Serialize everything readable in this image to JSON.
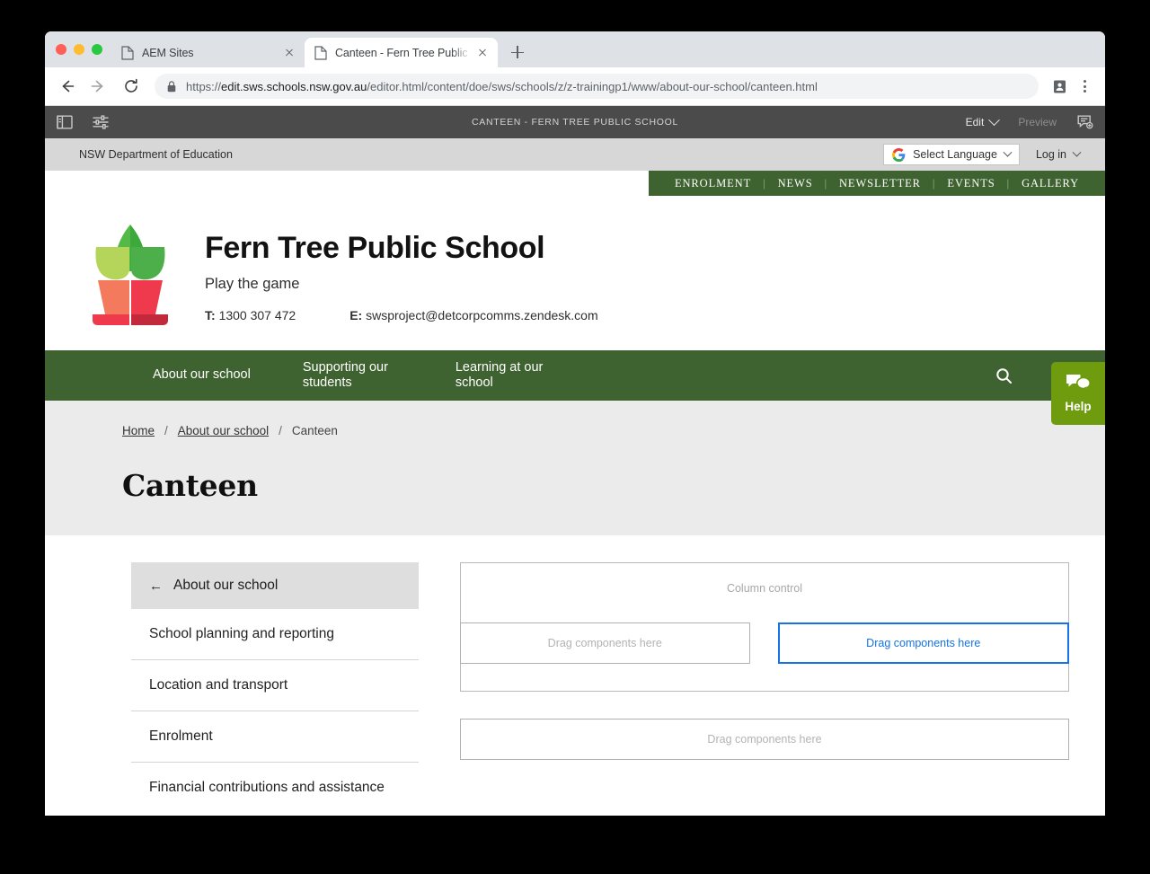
{
  "browser": {
    "tabs": [
      {
        "title": "AEM Sites",
        "active": false
      },
      {
        "title": "Canteen - Fern Tree Public Sch",
        "active": true
      }
    ],
    "url_full": "https://edit.sws.schools.nsw.gov.au/editor.html/content/doe/sws/schools/z/z-trainingp1/www/about-our-school/canteen.html",
    "url_domain": "edit.sws.schools.nsw.gov.au",
    "url_scheme": "https://",
    "url_path": "/editor.html/content/doe/sws/schools/z/z-trainingp1/www/about-our-school/canteen.html",
    "back_icon": "back-arrow-icon",
    "forward_icon": "forward-arrow-icon",
    "reload_icon": "reload-icon",
    "lock_icon": "lock-icon",
    "profile_icon": "profile-badge-icon",
    "menu_icon": "three-dot-menu-icon",
    "newtab_icon": "new-tab-plus-icon"
  },
  "aem": {
    "sidebar_toggle_icon": "side-panel-toggle-icon",
    "page_info_icon": "page-information-sliders-icon",
    "title": "CANTEEN - FERN TREE PUBLIC SCHOOL",
    "mode_label": "Edit",
    "preview_label": "Preview",
    "annotations_icon": "annotations-add-icon"
  },
  "nsw_bar": {
    "department": "NSW Department of Education",
    "language_label": "Select Language",
    "language_icon": "google-g-icon",
    "login_label": "Log in"
  },
  "utility_nav": {
    "items": [
      "ENROLMENT",
      "NEWS",
      "NEWSLETTER",
      "EVENTS",
      "GALLERY"
    ],
    "separator": "|"
  },
  "brand": {
    "logo_icon": "potted-plant-logo",
    "school_name": "Fern Tree Public School",
    "tagline": "Play the game",
    "phone_label": "T:",
    "phone": "1300 307 472",
    "email_label": "E:",
    "email": "swsproject@detcorpcomms.zendesk.com"
  },
  "main_nav": {
    "items": [
      "About our school",
      "Supporting our students",
      "Learning at our school"
    ],
    "search_icon": "search-magnifier-icon"
  },
  "breadcrumb": {
    "items": [
      "Home",
      "About our school",
      "Canteen"
    ],
    "separator": "/"
  },
  "page": {
    "title": "Canteen"
  },
  "sidebar": {
    "header": "About our school",
    "back_icon": "←",
    "items": [
      "School planning and reporting",
      "Location and transport",
      "Enrolment",
      "Financial contributions and assistance"
    ]
  },
  "editor_canvas": {
    "column_control_label": "Column control",
    "dropzone_left": "Drag components here",
    "dropzone_right": "Drag components here",
    "dropzone_bottom": "Drag components here",
    "selected_color": "#1473e6"
  },
  "help_widget": {
    "label": "Help",
    "icon": "chat-bubbles-icon",
    "color": "#6f9c0f"
  },
  "colors": {
    "brand_green": "#3e6330",
    "band_gray": "#ebebeb",
    "aem_bar": "#4b4b4b"
  }
}
